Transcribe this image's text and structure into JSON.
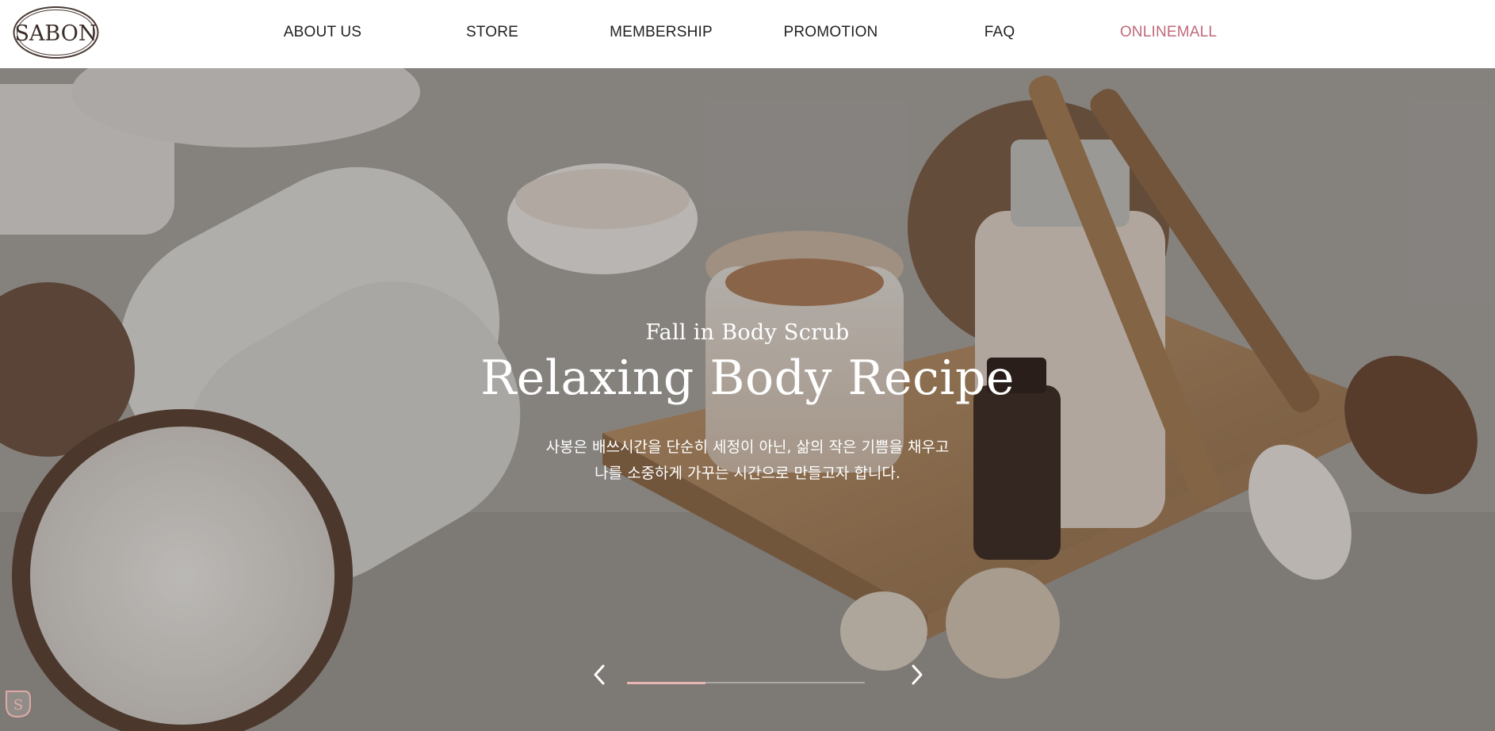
{
  "brand": {
    "logo_text": "SABON"
  },
  "nav": {
    "items": [
      {
        "label": "ABOUT US"
      },
      {
        "label": "STORE"
      },
      {
        "label": "MEMBERSHIP"
      },
      {
        "label": "PROMOTION"
      },
      {
        "label": "FAQ"
      },
      {
        "label": "ONLINEMALL"
      }
    ],
    "accent_color": "#c06a7b"
  },
  "hero": {
    "subtitle": "Fall in Body Scrub",
    "title": "Relaxing Body Recipe",
    "desc_line1": "사봉은 배쓰시간을 단순히 세정이 아닌, 삶의 작은 기쁨을 채우고",
    "desc_line2": "나를 소중하게 가꾸는 시간으로 만들고자 합니다."
  },
  "slider": {
    "prev_icon": "chevron-left-icon",
    "next_icon": "chevron-right-icon",
    "progress": 0.33,
    "progress_color": "#e8b7b5"
  },
  "badge": {
    "icon": "sabon-s-icon",
    "letter": "S"
  }
}
